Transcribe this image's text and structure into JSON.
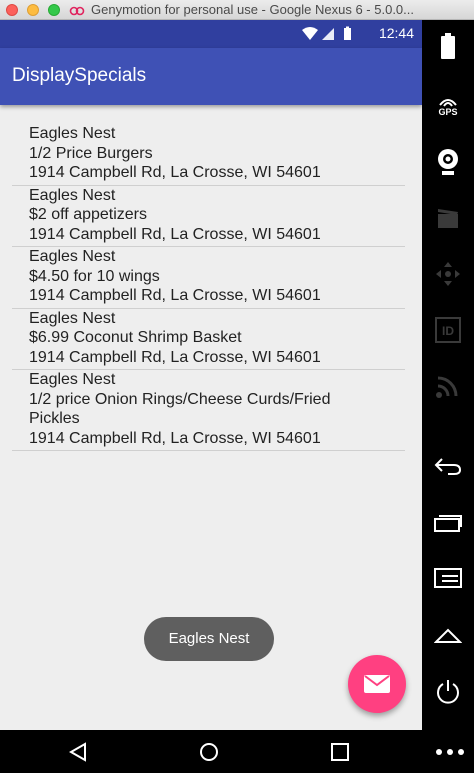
{
  "window": {
    "title": "Genymotion for personal use - Google Nexus 6 - 5.0.0..."
  },
  "status_bar": {
    "time": "12:44"
  },
  "app_bar": {
    "title": "DisplaySpecials"
  },
  "specials": [
    {
      "lines": [
        "Eagles Nest",
        "1/2 Price Burgers",
        "1914 Campbell Rd, La Crosse, WI 54601"
      ]
    },
    {
      "lines": [
        "Eagles Nest",
        "$2 off appetizers",
        "1914 Campbell Rd, La Crosse, WI 54601"
      ]
    },
    {
      "lines": [
        "Eagles Nest",
        "$4.50 for 10 wings",
        "1914 Campbell Rd, La Crosse, WI 54601"
      ]
    },
    {
      "lines": [
        "Eagles Nest",
        "$6.99 Coconut Shrimp Basket",
        "1914 Campbell Rd, La Crosse, WI 54601"
      ]
    },
    {
      "lines": [
        "Eagles Nest",
        "1/2 price Onion Rings/Cheese Curds/Fried",
        "Pickles",
        "1914 Campbell Rd, La Crosse, WI 54601"
      ]
    }
  ],
  "toast": {
    "text": "Eagles Nest"
  },
  "fab": {
    "icon": "email-icon",
    "color": "#ff4081"
  },
  "sidebar": {
    "gps_label": "GPS",
    "id_label": "ID"
  },
  "colors": {
    "primary": "#3f51b5",
    "primary_dark": "#303f9f",
    "accent": "#ff4081"
  }
}
